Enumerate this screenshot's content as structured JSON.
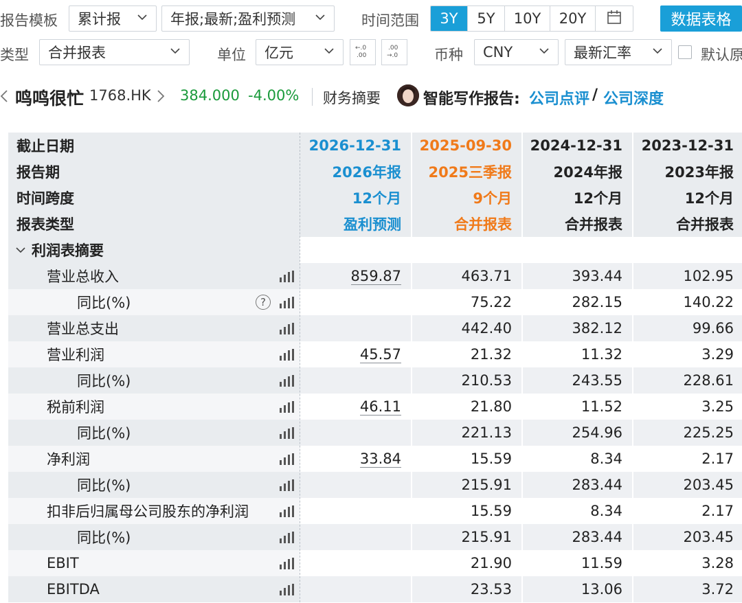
{
  "toolbar": {
    "report_template_label": "报告模板",
    "report_template_value": "累计报",
    "period_value": "年报;最新;盈利预测",
    "time_range_label": "时间范围",
    "time_range_options": [
      "3Y",
      "5Y",
      "10Y",
      "20Y"
    ],
    "time_range_selected": "3Y",
    "data_table_button": "数据表格",
    "type_label": "类型",
    "type_value": "合并报表",
    "unit_label": "单位",
    "unit_value": "亿元",
    "currency_label": "币种",
    "currency_value": "CNY",
    "fx_value": "最新汇率",
    "default_label": "默认原"
  },
  "stock": {
    "name": "鸣鸣很忙",
    "code": "1768.HK",
    "price": "384.000",
    "change": "-4.00%",
    "financial_summary": "财务摘要",
    "smart_report_label": "智能写作报告:",
    "link_review": "公司点评",
    "slash": "/",
    "link_depth": "公司深度"
  },
  "colors": {
    "accent": "#1a9fd8",
    "forecast": "#1a8fd0",
    "latest": "#f07a1a",
    "down": "#1a9a3b"
  },
  "table": {
    "header": {
      "labels": [
        "截止日期",
        "报告期",
        "时间跨度",
        "报表类型"
      ],
      "columns": [
        {
          "date": "2026-12-31",
          "period": "2026年报",
          "span": "12个月",
          "type": "盈利预测"
        },
        {
          "date": "2025-09-30",
          "period": "2025三季报",
          "span": "9个月",
          "type": "合并报表"
        },
        {
          "date": "2024-12-31",
          "period": "2024年报",
          "span": "12个月",
          "type": "合并报表"
        },
        {
          "date": "2023-12-31",
          "period": "2023年报",
          "span": "12个月",
          "type": "合并报表"
        }
      ]
    },
    "section_title": "利润表摘要",
    "rows": [
      {
        "name": "营业总收入",
        "values": [
          "859.87",
          "463.71",
          "393.44",
          "102.95"
        ]
      },
      {
        "name": "同比(%)",
        "values": [
          "",
          "75.22",
          "282.15",
          "140.22"
        ]
      },
      {
        "name": "营业总支出",
        "values": [
          "",
          "442.40",
          "382.12",
          "99.66"
        ]
      },
      {
        "name": "营业利润",
        "values": [
          "45.57",
          "21.32",
          "11.32",
          "3.29"
        ]
      },
      {
        "name": "同比(%)",
        "values": [
          "",
          "210.53",
          "243.55",
          "228.61"
        ]
      },
      {
        "name": "税前利润",
        "values": [
          "46.11",
          "21.80",
          "11.52",
          "3.25"
        ]
      },
      {
        "name": "同比(%)",
        "values": [
          "",
          "221.13",
          "254.96",
          "225.25"
        ]
      },
      {
        "name": "净利润",
        "values": [
          "33.84",
          "15.59",
          "8.34",
          "2.17"
        ]
      },
      {
        "name": "同比(%)",
        "values": [
          "",
          "215.91",
          "283.44",
          "203.45"
        ]
      },
      {
        "name": "扣非后归属母公司股东的净利润",
        "values": [
          "",
          "15.59",
          "8.34",
          "2.17"
        ]
      },
      {
        "name": "同比(%)",
        "values": [
          "",
          "215.91",
          "283.44",
          "203.45"
        ]
      },
      {
        "name": "EBIT",
        "values": [
          "",
          "21.90",
          "11.59",
          "3.28"
        ]
      },
      {
        "name": "EBITDA",
        "values": [
          "",
          "23.53",
          "13.06",
          "3.72"
        ]
      }
    ]
  }
}
